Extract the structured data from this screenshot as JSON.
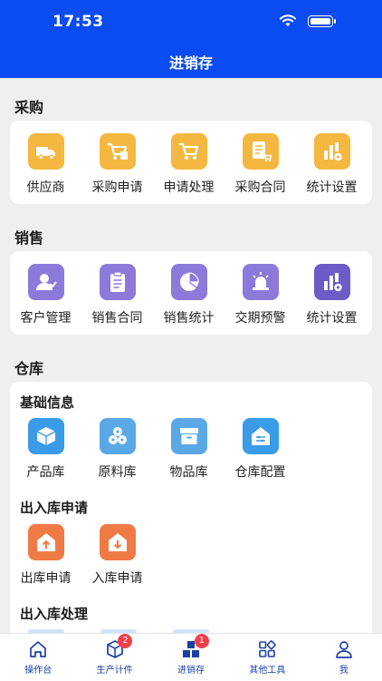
{
  "status": {
    "time": "17:53"
  },
  "header": {
    "title": "进销存"
  },
  "sections": {
    "purchase": {
      "title": "采购",
      "items": [
        {
          "label": "供应商",
          "icon": "truck-icon"
        },
        {
          "label": "采购申请",
          "icon": "cart-icon"
        },
        {
          "label": "申请处理",
          "icon": "cart-process-icon"
        },
        {
          "label": "采购合同",
          "icon": "contract-cart-icon"
        },
        {
          "label": "统计设置",
          "icon": "stats-gear-icon"
        }
      ]
    },
    "sales": {
      "title": "销售",
      "items": [
        {
          "label": "客户管理",
          "icon": "customer-icon"
        },
        {
          "label": "销售合同",
          "icon": "clipboard-icon"
        },
        {
          "label": "销售统计",
          "icon": "pie-chart-icon"
        },
        {
          "label": "交期预警",
          "icon": "alarm-icon"
        },
        {
          "label": "统计设置",
          "icon": "stats-gear-icon"
        }
      ]
    },
    "warehouse": {
      "title": "仓库",
      "basic": {
        "title": "基础信息",
        "items": [
          {
            "label": "产品库",
            "icon": "product-box-icon"
          },
          {
            "label": "原料库",
            "icon": "material-rolls-icon"
          },
          {
            "label": "物品库",
            "icon": "archive-box-icon"
          },
          {
            "label": "仓库配置",
            "icon": "warehouse-config-icon"
          }
        ]
      },
      "apply": {
        "title": "出入库申请",
        "items": [
          {
            "label": "出库申请",
            "icon": "outbound-icon"
          },
          {
            "label": "入库申请",
            "icon": "inbound-icon"
          }
        ]
      },
      "process": {
        "title": "出入库处理"
      }
    }
  },
  "tabbar": {
    "items": [
      {
        "label": "操作台",
        "icon": "home-icon"
      },
      {
        "label": "生产计件",
        "icon": "package-icon",
        "badge": "2"
      },
      {
        "label": "进销存",
        "icon": "blocks-icon",
        "badge": "1"
      },
      {
        "label": "其他工具",
        "icon": "apps-icon"
      },
      {
        "label": "我",
        "icon": "user-icon"
      }
    ]
  },
  "colors": {
    "brand": "#0a4bf2",
    "purchase_tile": "#f4b740",
    "sales_tile": "#8b7ad9",
    "warehouse_tile": "#3a9be8",
    "apply_tile": "#f07a45",
    "badge": "#ef3f4a",
    "tab_active": "#1a3ea8"
  }
}
